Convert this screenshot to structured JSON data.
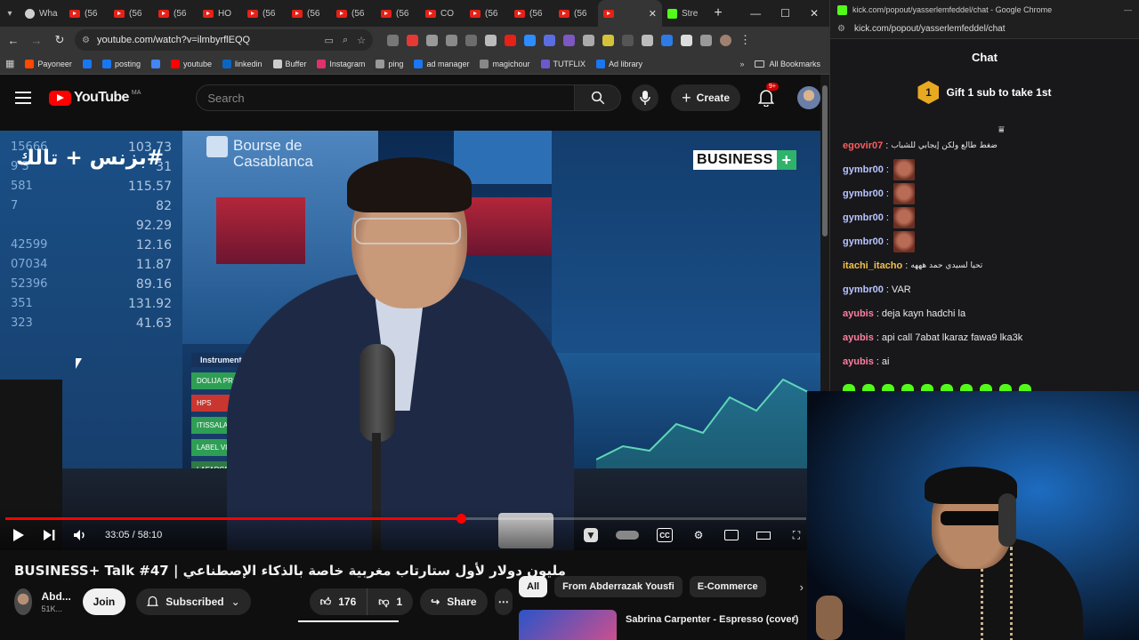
{
  "browser_left": {
    "tabs": [
      {
        "label": "Wha",
        "icon": "whatsapp-icon"
      },
      {
        "label": "(56",
        "icon": "youtube-icon"
      },
      {
        "label": "(56",
        "icon": "youtube-icon"
      },
      {
        "label": "(56",
        "icon": "youtube-icon"
      },
      {
        "label": "HO",
        "icon": "youtube-icon"
      },
      {
        "label": "(56",
        "icon": "youtube-icon"
      },
      {
        "label": "(56",
        "icon": "youtube-icon"
      },
      {
        "label": "(56",
        "icon": "youtube-icon"
      },
      {
        "label": "(56",
        "icon": "youtube-icon"
      },
      {
        "label": "CO",
        "icon": "youtube-icon"
      },
      {
        "label": "(56",
        "icon": "youtube-icon"
      },
      {
        "label": "(56",
        "icon": "youtube-icon"
      },
      {
        "label": "(56",
        "icon": "youtube-icon"
      },
      {
        "label": "",
        "icon": "youtube-icon",
        "active": true
      },
      {
        "label": "Stre",
        "icon": "kick-icon"
      }
    ],
    "close_tab_glyph": "✕",
    "new_tab_glyph": "+",
    "url": "youtube.com/watch?v=ilmbyrflEQQ",
    "bookmarks": [
      {
        "label": "Payoneer",
        "color": "#ff4800"
      },
      {
        "label": "",
        "color": "#1877f2"
      },
      {
        "label": "posting",
        "color": "#1877f2"
      },
      {
        "label": "",
        "color": "#4285f4"
      },
      {
        "label": "youtube",
        "color": "#ff0000"
      },
      {
        "label": "linkedin",
        "color": "#0a66c2"
      },
      {
        "label": "Buffer",
        "color": "#cccccc"
      },
      {
        "label": "Instagram",
        "color": "#e1306c"
      },
      {
        "label": "ping",
        "color": "#999999"
      },
      {
        "label": "ad manager",
        "color": "#1877f2"
      },
      {
        "label": "magichour",
        "color": "#888888"
      },
      {
        "label": "TUTFLIX",
        "color": "#6a5acd"
      },
      {
        "label": "Ad library",
        "color": "#1877f2"
      }
    ],
    "bookmarks_more": "»",
    "all_bookmarks": "All Bookmarks"
  },
  "youtube": {
    "logo_text": "YouTube",
    "region": "MA",
    "search_placeholder": "Search",
    "create_label": "Create",
    "notification_count": "9+",
    "video": {
      "overlay_title": "#بزنس + تالك",
      "brand": "BUSINESS",
      "brand_plus": "+",
      "bourse_text": "Bourse de Casablanca",
      "instrument_header": "Instrument",
      "instrument_rows": [
        "DOLIJA PROM ADD",
        "HPS",
        "ITISSALAT AL-MA",
        "LABEL VIE",
        "LAFARGEHOL"
      ],
      "ticker_rows": [
        {
          "a": "15666",
          "b": "103.73"
        },
        {
          "a": "9 3",
          "b": "31"
        },
        {
          "a": "581",
          "b": "115.57"
        },
        {
          "a": "7",
          "b": "82"
        },
        {
          "a": "",
          "b": "92.29"
        },
        {
          "a": "42599",
          "b": "12.16"
        },
        {
          "a": "07034",
          "b": "11.87"
        },
        {
          "a": "52396",
          "b": "89.16"
        },
        {
          "a": "351",
          "b": "131.92"
        },
        {
          "a": "323",
          "b": "41.63"
        }
      ],
      "current_time": "33:05",
      "duration": "58:10",
      "progress": 0.5688
    },
    "title": "BUSINESS+ Talk #47 | مليون دولار لأول ستارتاب مغربية خاصة بالذكاء الإصطناعي",
    "channel": {
      "name": "Abd...",
      "subs": "51K...",
      "join_label": "Join",
      "subscribed_label": "Subscribed"
    },
    "likes": "176",
    "dislikes": "1",
    "share_label": "Share",
    "chips": [
      "All",
      "From Abderrazak Yousfi",
      "E-Commerce"
    ],
    "recommendation": {
      "title": "Sabrina Carpenter - Espresso (cover)"
    }
  },
  "chat_window": {
    "title_bar": "kick.com/popout/yasserlemfeddel/chat - Google Chrome",
    "url": "kick.com/popout/yasserlemfeddel/chat",
    "header": "Chat",
    "gift_rank": "1",
    "gift_text": "Gift 1 sub to take 1st",
    "messages": [
      {
        "user": "egovir07",
        "color": "#ff5c5c",
        "text": "ضغط طالع ولكن إيجابي للشباب",
        "rtl": true
      },
      {
        "user": "gymbr00",
        "color": "#b9c4ff",
        "text": "",
        "emote": true
      },
      {
        "user": "gymbr00",
        "color": "#b9c4ff",
        "text": "",
        "emote": true
      },
      {
        "user": "gymbr00",
        "color": "#b9c4ff",
        "text": "",
        "emote": true
      },
      {
        "user": "gymbr00",
        "color": "#b9c4ff",
        "text": "",
        "emote": true
      },
      {
        "user": "itachi_itacho",
        "color": "#f0c14b",
        "text": "تحيا لسيدي حمد هههه",
        "rtl": true
      },
      {
        "user": "gymbr00",
        "color": "#b9c4ff",
        "text": "VAR"
      },
      {
        "user": "ayubis",
        "color": "#ff7f9f",
        "text": "deja kayn hadchi la"
      },
      {
        "user": "ayubis",
        "color": "#ff7f9f",
        "text": "api call 7abat lkaraz fawa9 lka3k"
      },
      {
        "user": "ayubis",
        "color": "#ff7f9f",
        "text": "ai"
      }
    ]
  }
}
